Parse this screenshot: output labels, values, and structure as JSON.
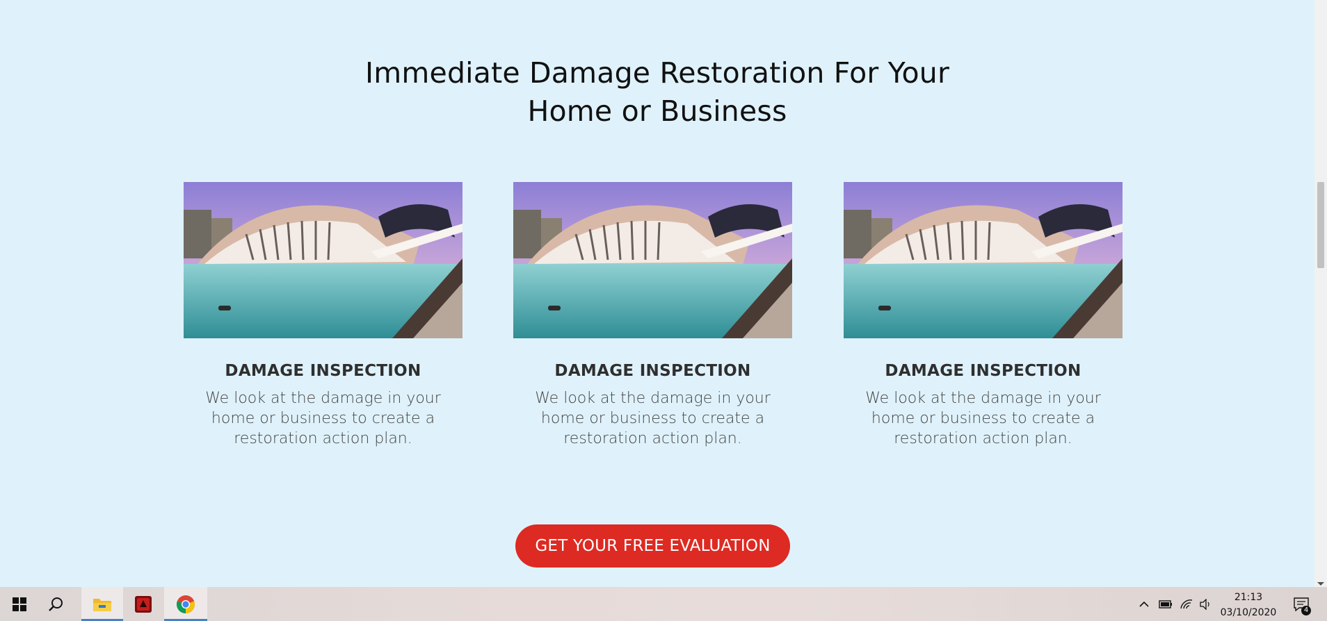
{
  "page": {
    "headline_line1": "Immediate Damage Restoration For Your",
    "headline_line2": "Home or Business",
    "cards": [
      {
        "title": "DAMAGE INSPECTION",
        "text": "We look at the damage in your home or business to create a restoration action plan."
      },
      {
        "title": "DAMAGE INSPECTION",
        "text": "We look at the damage in your home or business to create a restoration action plan."
      },
      {
        "title": "DAMAGE INSPECTION",
        "text": "We look at the damage in your home or business to create a restoration action plan."
      }
    ],
    "cta_label": "GET YOUR FREE EVALUATION"
  },
  "colors": {
    "page_background": "#dff2fb",
    "cta_background": "#dd2a22",
    "heading_text": "#111111",
    "card_title": "#2f2f2f",
    "card_text": "#444444"
  },
  "taskbar": {
    "pinned": [
      {
        "icon": "windows-start-icon"
      },
      {
        "icon": "search-icon"
      },
      {
        "icon": "file-explorer-icon"
      },
      {
        "icon": "red-app-icon"
      },
      {
        "icon": "chrome-icon"
      }
    ],
    "tray": {
      "time": "21:13",
      "date": "03/10/2020",
      "notification_count": "4"
    }
  }
}
